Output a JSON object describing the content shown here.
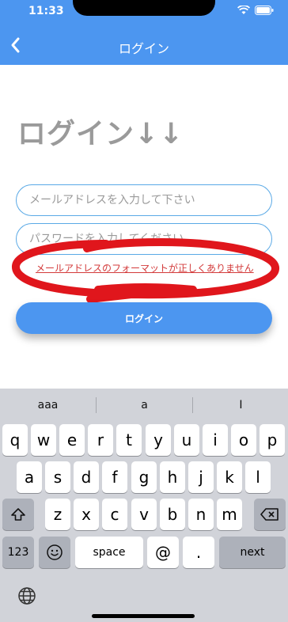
{
  "status_bar": {
    "time": "11:33"
  },
  "nav": {
    "title": "ログイン"
  },
  "page": {
    "heading": "ログイン↓↓"
  },
  "form": {
    "email_placeholder": "メールアドレスを入力して下さい",
    "password_placeholder": "パスワードを入力してください",
    "error": "メールアドレスのフォーマットが正しくありません",
    "login_label": "ログイン"
  },
  "keyboard": {
    "suggestions": [
      "aaa",
      "a",
      "I"
    ],
    "row1": [
      "q",
      "w",
      "e",
      "r",
      "t",
      "y",
      "u",
      "i",
      "o",
      "p"
    ],
    "row2": [
      "a",
      "s",
      "d",
      "f",
      "g",
      "h",
      "j",
      "k",
      "l"
    ],
    "row3": [
      "z",
      "x",
      "c",
      "v",
      "b",
      "n",
      "m"
    ],
    "numbers_label": "123",
    "space_label": "space",
    "at_label": "@",
    "dot_label": ".",
    "next_label": "next"
  },
  "colors": {
    "accent": "#4c96f0",
    "error": "#d33a3a",
    "annotation": "#e0161c"
  }
}
